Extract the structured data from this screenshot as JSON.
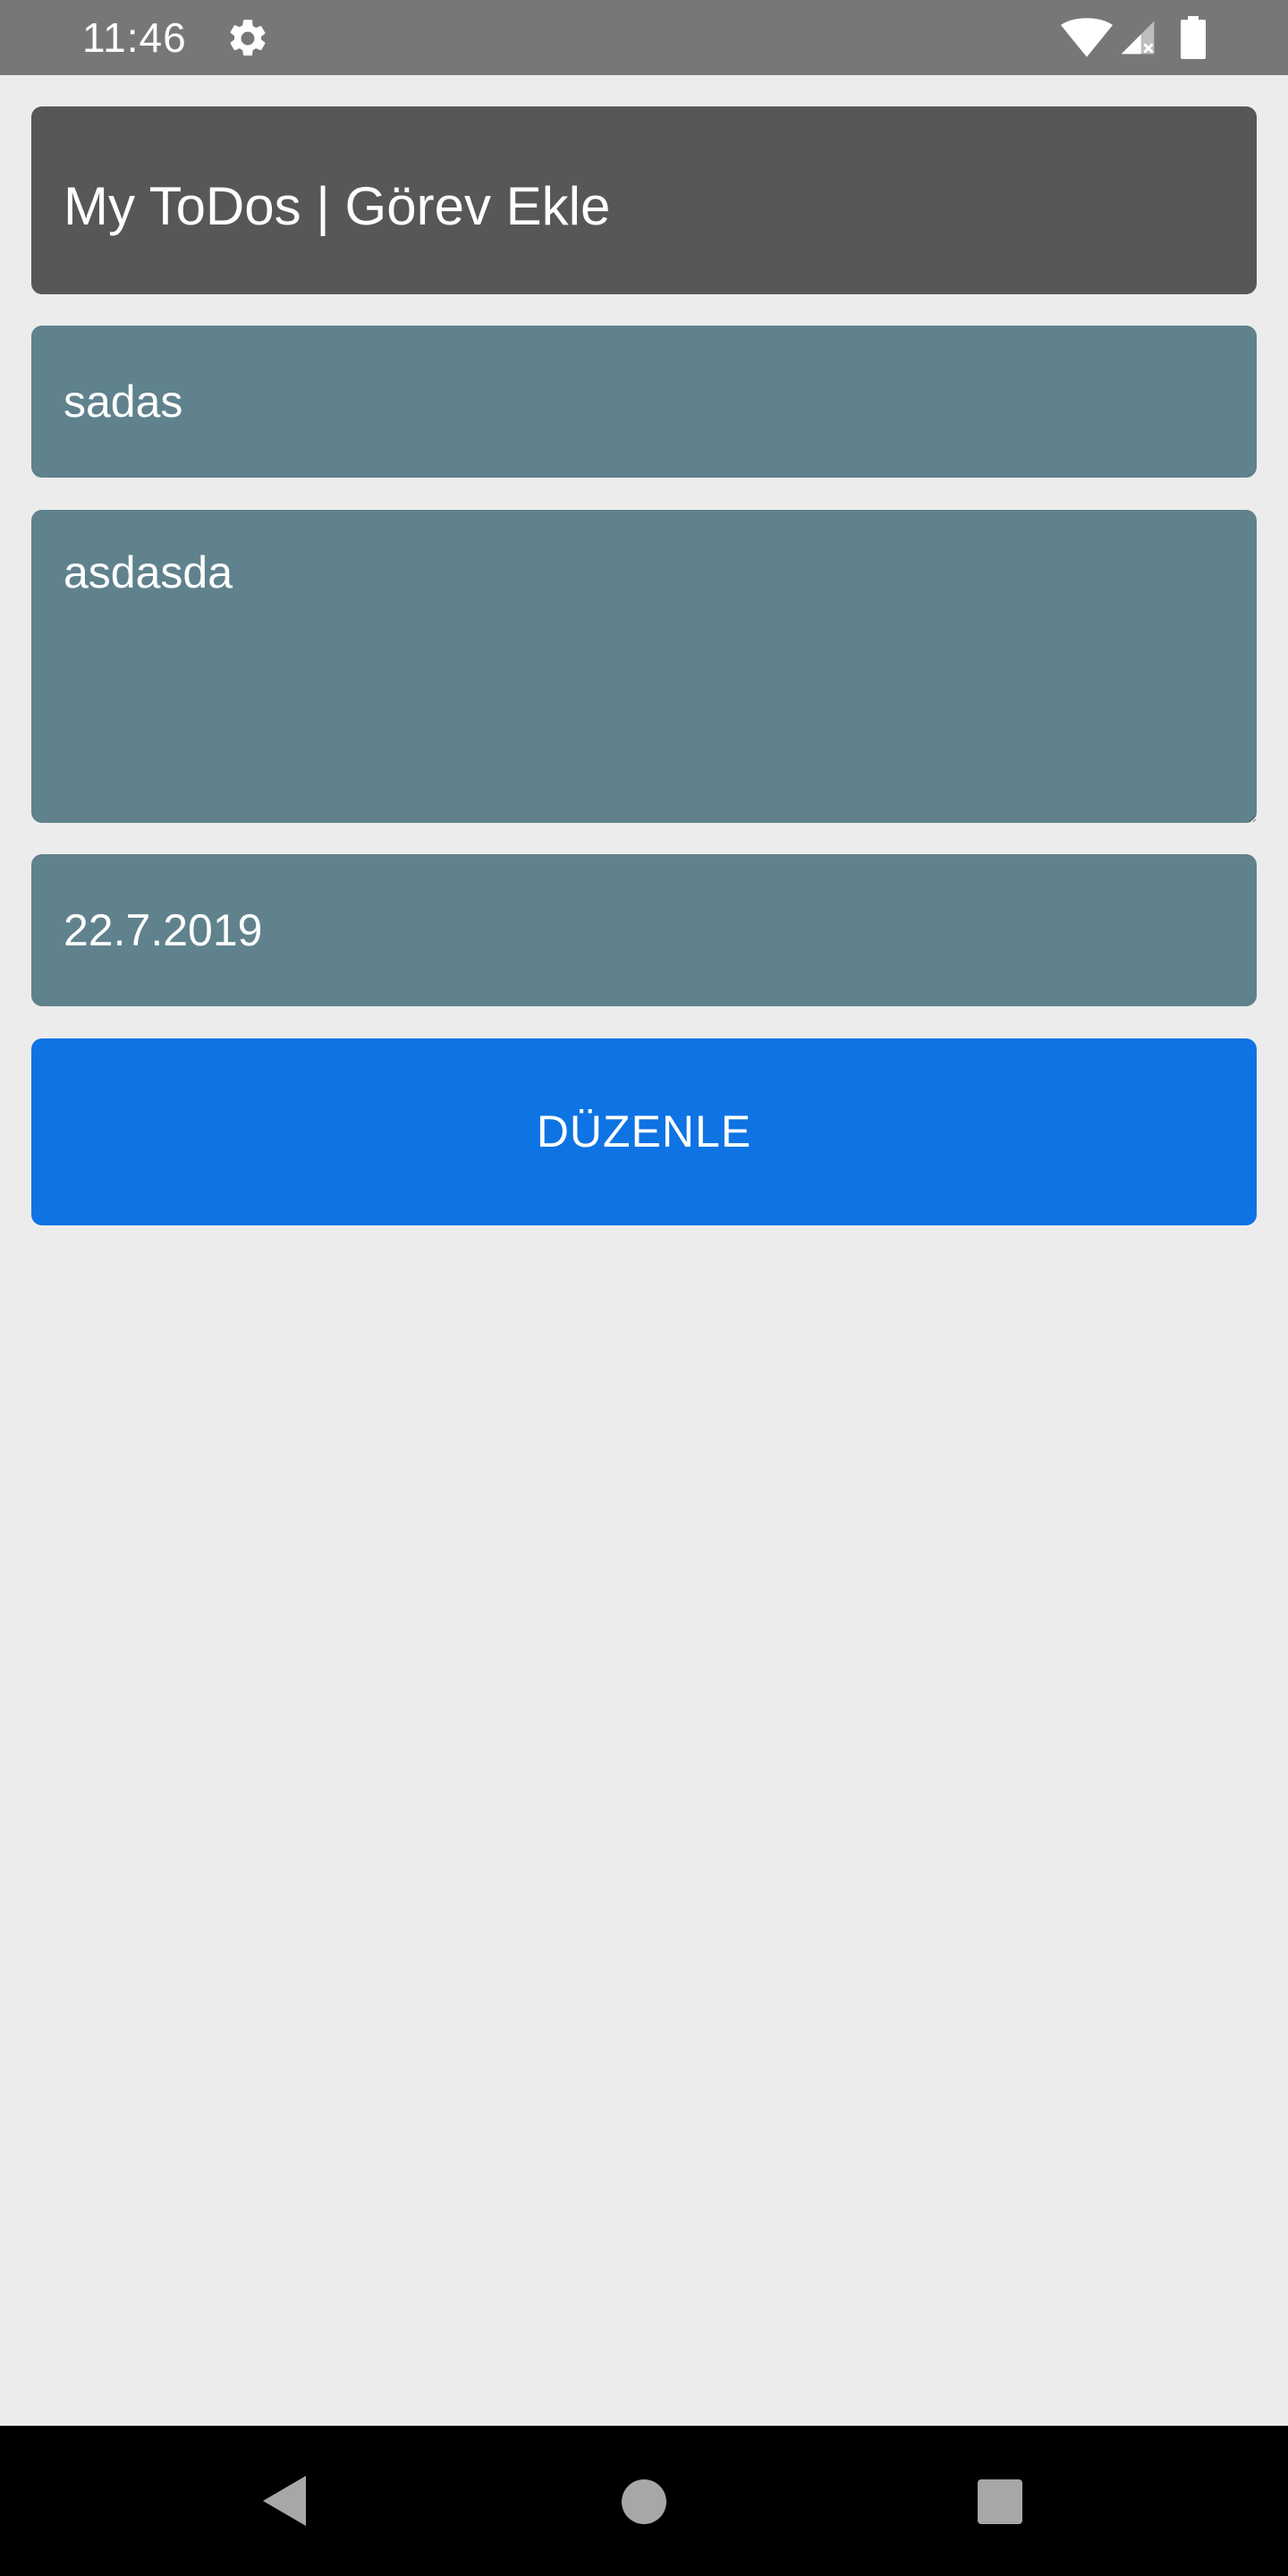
{
  "status_bar": {
    "time": "11:46",
    "icons": [
      "gear-icon",
      "wifi-icon",
      "signal-icon",
      "battery-icon"
    ]
  },
  "header": {
    "title": "My ToDos | Görev Ekle"
  },
  "form": {
    "title_value": "sadas",
    "description_value": "asdasda",
    "date_value": "22.7.2019",
    "submit_label": "DÜZENLE"
  },
  "nav_bar": {
    "icons": [
      "back-icon",
      "home-icon",
      "recents-icon"
    ]
  },
  "colors": {
    "status_bar": "#777777",
    "background": "#ececec",
    "header_card": "#575757",
    "field": "#5f828d",
    "button": "#0e73e3",
    "nav_bar": "#000000"
  }
}
